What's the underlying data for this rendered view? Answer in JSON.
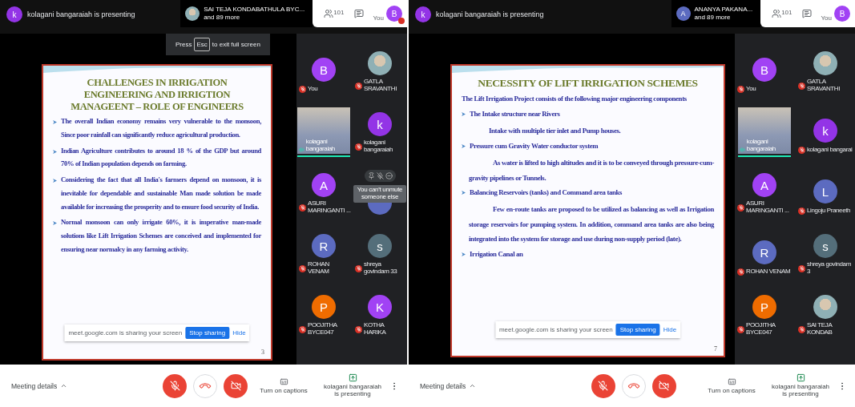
{
  "screens": [
    {
      "presenter": {
        "initial": "k",
        "color": "#9334e6",
        "text": "kolagani bangaraiah is presenting"
      },
      "speaker": {
        "avatar": {
          "kind": "photo"
        },
        "name": "SAI TEJA KONDABATHULA BYC...",
        "more": "and 89 more"
      },
      "participant_count": "101",
      "self": {
        "label": "You",
        "initial": "B",
        "color": "#a142f4",
        "alert": true
      },
      "fullscreen_hint": {
        "before": "Press",
        "key": "Esc",
        "after": "to exit full screen"
      },
      "slide": {
        "title": "CHALLENGES IN IRRIGATION ENGINEERING AND IRRIGTION MANAGEENT – ROLE OF ENGINEERS",
        "page": "3",
        "items": [
          {
            "kind": "bullet",
            "text": "The overall Indian economy remains very vulnerable to the monsoon, Since poor rainfall can significantly reduce agricultural production."
          },
          {
            "kind": "bullet",
            "text": "Indian Agriculture contributes to around 18 % of the GDP but around 70% of Indian population depends on farming."
          },
          {
            "kind": "bullet",
            "text": "Considering the fact that all India's farmers depend on monsoon, it is inevitable for dependable and sustainable  Man made solution be made available for increasing the prosperity and to ensure food security of India."
          },
          {
            "kind": "bullet",
            "text": "Normal monsoon can only irrigate 60%, it is imperative man-made solutions like Lift Irrigation Schemes are conceived and implemented for ensuring near normalcy in any farming activity."
          }
        ],
        "share_bar": {
          "text": "meet.google.com is sharing your screen",
          "button": "Stop sharing",
          "hide": "Hide"
        }
      },
      "tiles": [
        {
          "kind": "avatar",
          "name": "You",
          "initial": "B",
          "color": "#a142f4",
          "muted": true
        },
        {
          "kind": "photo",
          "name": "GATLA SRAVANTHI",
          "muted": true
        },
        {
          "kind": "video",
          "name": "kolagani bangaraiah",
          "muted": false
        },
        {
          "kind": "avatar",
          "name": "kolagani bangaraiah",
          "initial": "k",
          "color": "#9334e6",
          "muted": true
        },
        {
          "kind": "avatar",
          "name": "ASURI MARINGANTI ...",
          "initial": "A",
          "color": "#a142f4",
          "muted": true
        },
        {
          "kind": "hovered",
          "color": "#5c6bc0",
          "tooltip": "You can't unmute someone else",
          "muted": true
        },
        {
          "kind": "avatar",
          "name": "ROHAN VENAM",
          "initial": "R",
          "color": "#5c6bc0",
          "muted": true
        },
        {
          "kind": "avatar",
          "name": "shreya govindam 33",
          "initial": "s",
          "color": "#546e7a",
          "muted": true
        },
        {
          "kind": "avatar",
          "name": "POOJITHA BYCE047",
          "initial": "P",
          "color": "#ef6c00",
          "muted": true
        },
        {
          "kind": "avatar",
          "name": "KOTHA HARIKA",
          "initial": "K",
          "color": "#a142f4",
          "muted": true
        }
      ],
      "footer": {
        "details": "Meeting details",
        "captions": "Turn on captions",
        "presenting": "kolagani bangaraiah is presenting"
      }
    },
    {
      "presenter": {
        "initial": "k",
        "color": "#9334e6",
        "text": "kolagani bangaraiah is presenting"
      },
      "speaker": {
        "avatar": {
          "kind": "initial",
          "initial": "A",
          "color": "#5c6bc0"
        },
        "name": "ANANYA PAKANA...",
        "more": "and 89 more"
      },
      "participant_count": "101",
      "self": {
        "label": "You",
        "initial": "B",
        "color": "#a142f4",
        "alert": false
      },
      "slide": {
        "title": "NECESSITY OF LIFT IRRIGATION SCHEMES",
        "page": "7",
        "items": [
          {
            "kind": "intro",
            "text": "The Lift Irrigation Project consists of the following major engineering components"
          },
          {
            "kind": "bullet",
            "text": "The Intake structure near Rivers"
          },
          {
            "kind": "indent",
            "text": "Intake with multiple tier inlet and Pump houses."
          },
          {
            "kind": "bullet",
            "text": "Pressure cum Gravity Water conductor system"
          },
          {
            "kind": "para",
            "text": "As water is lifted to high altitudes and it is to be conveyed through pressure-cum-gravity pipelines or Tunnels."
          },
          {
            "kind": "bullet",
            "text": "Balancing Reservoirs (tanks) and Command area tanks"
          },
          {
            "kind": "para",
            "text": "Few en-route tanks are proposed to be utilized as balancing as well as Irrigation storage reservoirs for pumping system. In addition, command area tanks are also being integrated into the system for storage and use during non-supply period (late)."
          },
          {
            "kind": "bullet",
            "text": "Irrigation Canal an"
          }
        ],
        "share_bar": {
          "text": "meet.google.com is sharing your screen",
          "button": "Stop sharing",
          "hide": "Hide"
        }
      },
      "tiles": [
        {
          "kind": "avatar",
          "name": "You",
          "initial": "B",
          "color": "#a142f4",
          "muted": true
        },
        {
          "kind": "photo",
          "name": "GATLA SRAVANTHI",
          "muted": true
        },
        {
          "kind": "video",
          "name": "kolagani bangaraiah",
          "muted": false
        },
        {
          "kind": "avatar",
          "name": "kolagani bangarai",
          "initial": "k",
          "color": "#9334e6",
          "muted": true
        },
        {
          "kind": "avatar",
          "name": "ASURI MARINGANTI ...",
          "initial": "A",
          "color": "#a142f4",
          "muted": true
        },
        {
          "kind": "avatar",
          "name": "Lingoju Praneeth",
          "initial": "L",
          "color": "#5c6bc0",
          "muted": true
        },
        {
          "kind": "avatar",
          "name": "ROHAN VENAM",
          "initial": "R",
          "color": "#5c6bc0",
          "muted": true
        },
        {
          "kind": "avatar",
          "name": "shreya govindam 3",
          "initial": "s",
          "color": "#546e7a",
          "muted": true
        },
        {
          "kind": "avatar",
          "name": "POOJITHA BYCE047",
          "initial": "P",
          "color": "#ef6c00",
          "muted": true
        },
        {
          "kind": "photo",
          "name": "SAI TEJA KONDAB",
          "muted": true
        }
      ],
      "footer": {
        "details": "Meeting details",
        "captions": "Turn on captions",
        "presenting": "kolagani bangaraiah is presenting"
      }
    }
  ]
}
